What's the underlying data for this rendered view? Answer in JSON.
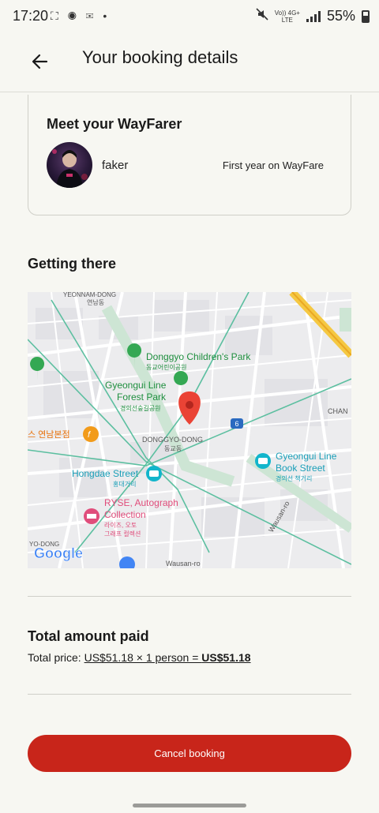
{
  "status_bar": {
    "time": "17:20",
    "network_label_top": "Vo)) 4G+",
    "network_label_bottom": "LTE",
    "battery_text": "55%"
  },
  "header": {
    "title": "Your booking details",
    "back_icon": "arrow-left-icon"
  },
  "host": {
    "title": "Meet your WayFarer",
    "name": "faker",
    "since": "First year on WayFare"
  },
  "getting_there": {
    "title": "Getting there",
    "map_labels": {
      "yeonnam": "YEONNAM-DONG",
      "yeonnam_kr": "연남동",
      "park1": "Donggyo Children's Park",
      "park1_kr": "동교어린이공원",
      "park2_l1": "Gyeongui Line",
      "park2_l2": "Forest Park",
      "park2_kr": "경의선숲길공원",
      "donggyo": "DONGGYO-DONG",
      "donggyo_kr": "동교동",
      "chan": "CHAN",
      "road6": "6",
      "book_l1": "Gyeongui Line",
      "book_l2": "Book Street",
      "book_kr": "경의선 책거리",
      "hongdae": "Hongdae Street",
      "hongdae_kr": "홍대거리",
      "ryse_l1": "RYSE, Autograph",
      "ryse_l2": "Collection",
      "ryse_kr1": "라이즈, 오토",
      "ryse_kr2": "그래프 컬렉션",
      "yeonnam_store": "스 연남본점",
      "wausan1": "Wausan-ro",
      "wausan2": "Wausan-ro",
      "yo_dong": "YO-DONG",
      "google": "Google"
    }
  },
  "total": {
    "title": "Total amount paid",
    "label": "Total price: ",
    "calc": "US$51.18 × 1 person = ",
    "final": "US$51.18"
  },
  "cancel_button": {
    "label": "Cancel booking"
  },
  "colors": {
    "accent_red": "#c8251a",
    "map_green": "#34a853",
    "map_blue": "#1a9fb8",
    "map_pink": "#e04d7b"
  }
}
